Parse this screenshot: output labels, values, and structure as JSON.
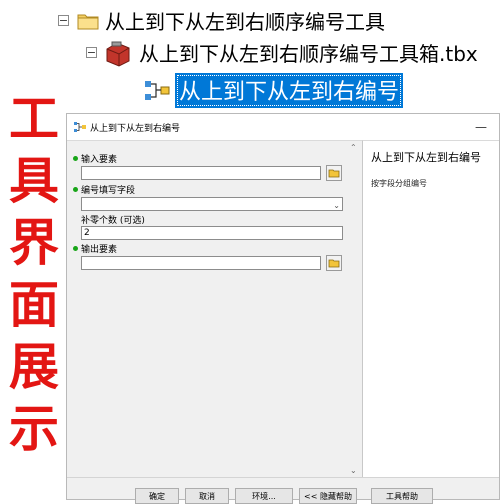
{
  "catalog_tree": {
    "folder": {
      "expander": "−",
      "label": "从上到下从左到右顺序编号工具"
    },
    "toolbox": {
      "expander": "−",
      "label": "从上到下从左到右顺序编号工具箱.tbx"
    },
    "tool": {
      "label": "从上到下从左到右编号"
    }
  },
  "caption": [
    "工",
    "具",
    "界",
    "面",
    "展",
    "示"
  ],
  "dialog": {
    "title": "从上到下从左到右编号",
    "minimize": "—",
    "params": {
      "input_label": "输入要素",
      "input_value": "",
      "field_label": "编号填写字段",
      "field_value": "",
      "padding_label": "补零个数 (可选)",
      "padding_value": "2",
      "output_label": "输出要素",
      "output_value": ""
    },
    "help": {
      "title": "从上到下从左到右编号",
      "text": "按字段分组编号"
    },
    "buttons": {
      "ok": "确定",
      "cancel": "取消",
      "env": "环境...",
      "hide_help": "<< 隐藏帮助",
      "tool_help": "工具帮助"
    }
  },
  "colors": {
    "selection": "#0078d7",
    "caption": "#e31613",
    "required_dot": "#18a518"
  }
}
